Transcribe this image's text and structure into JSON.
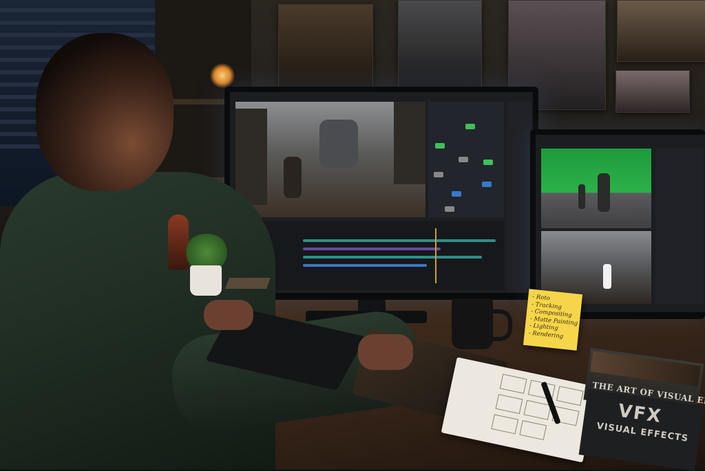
{
  "scene": {
    "sticky_note": {
      "lines": [
        "- Roto",
        "- Tracking",
        "- Compositing",
        "- Matte Painting",
        "- Lighting",
        "- Rendering"
      ],
      "color": "#f6d54a"
    },
    "book_top": {
      "title": "THE ART OF VISUAL EFFECTS"
    },
    "book_bottom": {
      "title": "VFX",
      "subtitle": "VISUAL EFFECTS"
    },
    "colors": {
      "green_screen": "#2bb14a",
      "node_green": "#3fbf5a",
      "node_blue": "#3a78c9",
      "timeline_teal": "#2e8f8a",
      "lamp_glow": "#ffd27a"
    }
  }
}
